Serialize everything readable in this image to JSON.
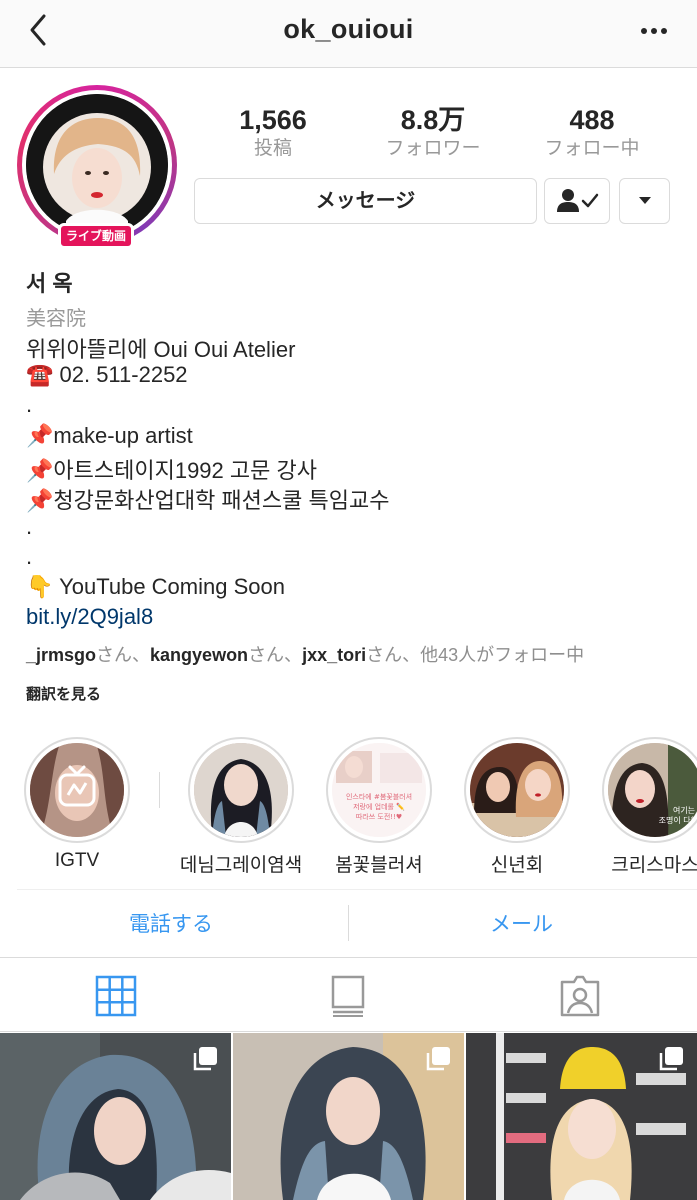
{
  "header": {
    "title": "ok_ouioui",
    "back_icon": "chevron-left-icon",
    "more_icon": "more-horizontal-icon"
  },
  "profile": {
    "live_badge": "ライブ動画",
    "stats": [
      {
        "value": "1,566",
        "label": "投稿"
      },
      {
        "value": "8.8万",
        "label": "フォロワー"
      },
      {
        "value": "488",
        "label": "フォロー中"
      }
    ],
    "message_button": "メッセージ",
    "following_icon": "user-check-icon",
    "dropdown_icon": "caret-down-icon"
  },
  "bio": {
    "name": "서 옥",
    "category": "美容院",
    "lines": [
      "위위아뜰리에 Oui Oui Atelier",
      "☎️ 02. 511-2252",
      ".",
      "📌make-up artist",
      "📌아트스테이지1992 고문 강사",
      "📌청강문화산업대학 패션스쿨 특임교수",
      ".",
      ".",
      "👇 YouTube Coming Soon"
    ],
    "link": "bit.ly/2Q9jal8",
    "followed_by": {
      "users": [
        "_jrmsgo",
        "kangyewon",
        "jxx_tori"
      ],
      "suffix": "さん、",
      "last_suffix": "さん、他43人がフォロー中"
    },
    "translate": "翻訳を見る"
  },
  "highlights": [
    {
      "label": "IGTV",
      "icon": "igtv-icon"
    },
    {
      "label": "데님그레이염색"
    },
    {
      "label": "봄꽃블러셔",
      "overlay_text": "인스타에 #봄꽃블러셔 저랑에 업데롤 ✏️ 따라쓰 도전!!♥ 해봐!!"
    },
    {
      "label": "신년회"
    },
    {
      "label": "크리스마스",
      "overlay_text": "여기는 조명이 다했네"
    }
  ],
  "contact": {
    "call": "電話する",
    "email": "メール"
  },
  "tabs": [
    {
      "name": "grid",
      "icon": "grid-icon",
      "active": true
    },
    {
      "name": "feed",
      "icon": "feed-list-icon",
      "active": false
    },
    {
      "name": "tagged",
      "icon": "tagged-person-icon",
      "active": false
    }
  ],
  "colors": {
    "accent": "#3897f0",
    "link": "#00376b",
    "live": "#e4145b",
    "ring_start": "#d6249f",
    "ring_end": "#833ab4"
  }
}
